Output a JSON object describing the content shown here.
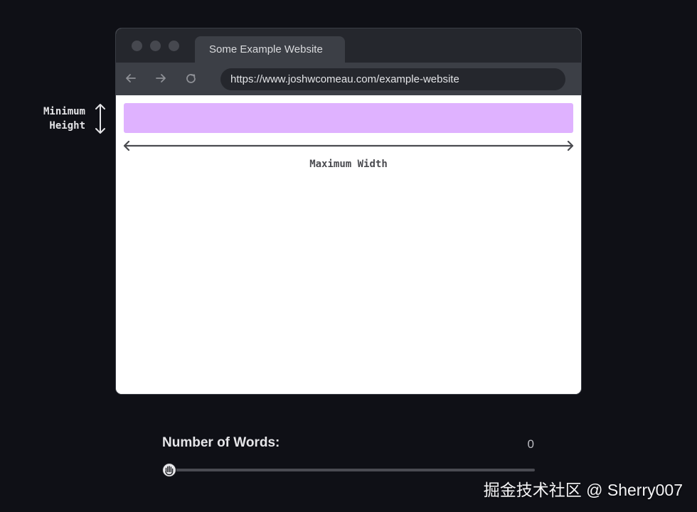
{
  "browser": {
    "tab_title": "Some Example Website",
    "url": "https://www.joshwcomeau.com/example-website",
    "icons": {
      "back": "arrow-left-icon",
      "forward": "arrow-right-icon",
      "reload": "reload-icon"
    }
  },
  "annotations": {
    "min_height_line1": "Minimum",
    "min_height_line2": "Height",
    "max_width": "Maximum Width"
  },
  "colors": {
    "page_background": "#0f1016",
    "content_box": "#dfb2ff",
    "slider_accent": "#c9a3ff"
  },
  "slider": {
    "label": "Number of Words:",
    "value": "0",
    "value_fraction": 0
  },
  "watermark": "掘金技术社区 @ Sherry007"
}
